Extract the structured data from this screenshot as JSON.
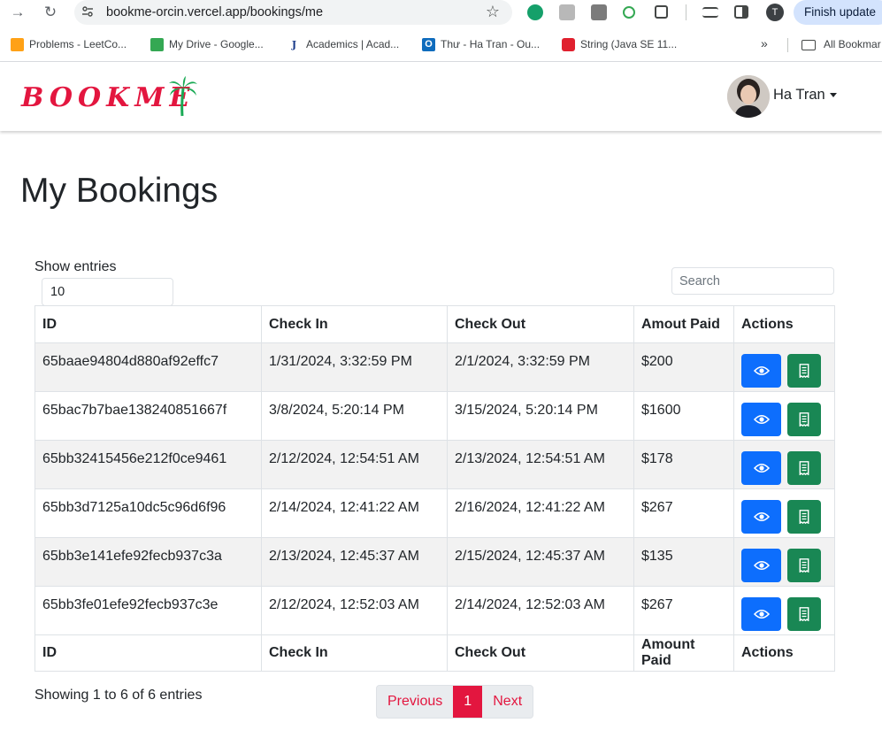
{
  "browser": {
    "url": "bookme-orcin.vercel.app/bookings/me",
    "finish_update": "Finish update",
    "profile_initial": "T",
    "bookmarks": [
      {
        "label": "Problems - LeetCo...",
        "icon": "leetcode-icon"
      },
      {
        "label": "My Drive - Google...",
        "icon": "google-drive-icon"
      },
      {
        "label": "Academics | Acad...",
        "icon": "j-icon"
      },
      {
        "label": "Thư - Ha Tran - Ou...",
        "icon": "outlook-icon"
      },
      {
        "label": "String (Java SE 11...",
        "icon": "oracle-icon"
      }
    ],
    "all_bookmarks": "All Bookmar"
  },
  "app": {
    "logo_text": "BOOKME",
    "brand_color": "#e3163f",
    "user_name": "Ha Tran"
  },
  "page": {
    "title": "My Bookings",
    "show_entries_label": "Show entries",
    "page_length_value": "10",
    "search_placeholder": "Search"
  },
  "table": {
    "headers": [
      "ID",
      "Check In",
      "Check Out",
      "Amout Paid",
      "Actions"
    ],
    "footers": [
      "ID",
      "Check In",
      "Check Out",
      "Amount Paid",
      "Actions"
    ],
    "rows": [
      {
        "id": "65baae94804d880af92effc7",
        "check_in": "1/31/2024, 3:32:59 PM",
        "check_out": "2/1/2024, 3:32:59 PM",
        "amount": "$200"
      },
      {
        "id": "65bac7b7bae138240851667f",
        "check_in": "3/8/2024, 5:20:14 PM",
        "check_out": "3/15/2024, 5:20:14 PM",
        "amount": "$1600"
      },
      {
        "id": "65bb32415456e212f0ce9461",
        "check_in": "2/12/2024, 12:54:51 AM",
        "check_out": "2/13/2024, 12:54:51 AM",
        "amount": "$178"
      },
      {
        "id": "65bb3d7125a10dc5c96d6f96",
        "check_in": "2/14/2024, 12:41:22 AM",
        "check_out": "2/16/2024, 12:41:22 AM",
        "amount": "$267"
      },
      {
        "id": "65bb3e141efe92fecb937c3a",
        "check_in": "2/13/2024, 12:45:37 AM",
        "check_out": "2/15/2024, 12:45:37 AM",
        "amount": "$135"
      },
      {
        "id": "65bb3fe01efe92fecb937c3e",
        "check_in": "2/12/2024, 12:52:03 AM",
        "check_out": "2/14/2024, 12:52:03 AM",
        "amount": "$267"
      }
    ],
    "view_color": "#0d6efd",
    "receipt_color": "#198754"
  },
  "footer": {
    "info": "Showing 1 to 6 of 6 entries",
    "previous": "Previous",
    "current_page": "1",
    "next": "Next"
  }
}
